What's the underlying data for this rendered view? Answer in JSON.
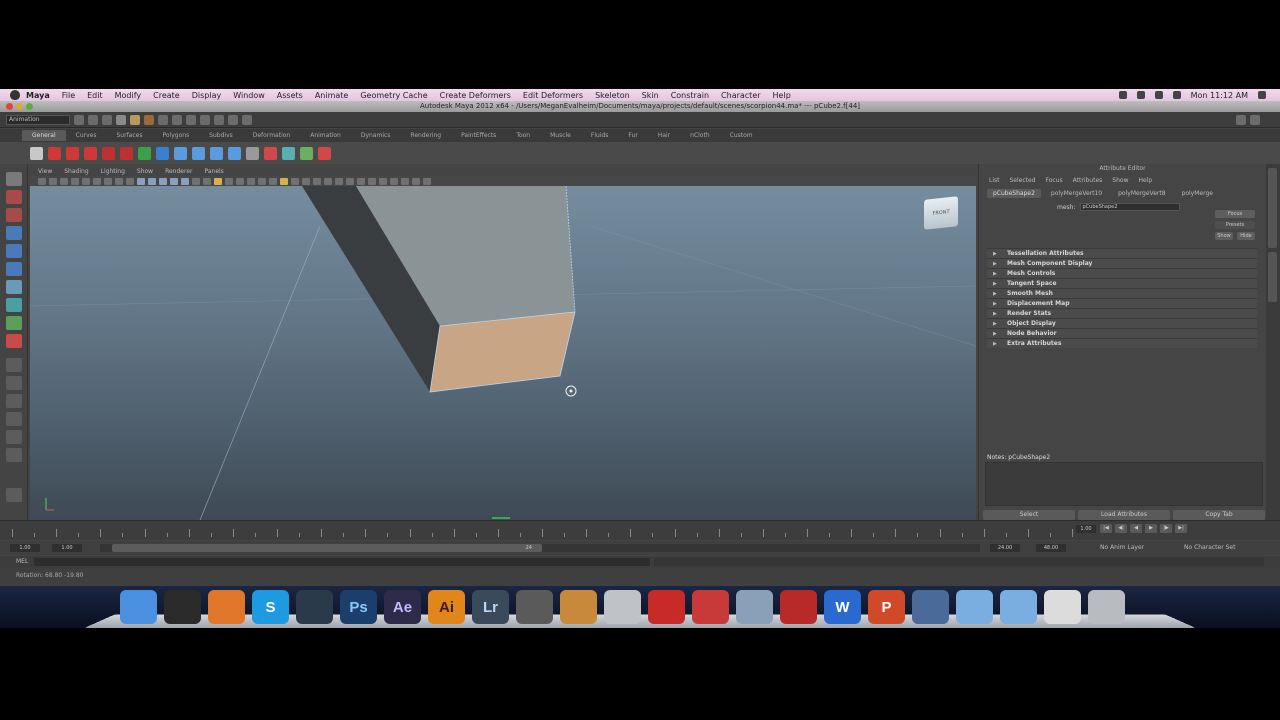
{
  "menubar": {
    "app": "Maya",
    "items": [
      "File",
      "Edit",
      "Modify",
      "Create",
      "Display",
      "Window",
      "Assets",
      "Animate",
      "Geometry Cache",
      "Create Deformers",
      "Edit Deformers",
      "Skeleton",
      "Skin",
      "Constrain",
      "Character",
      "Help"
    ],
    "clock": "Mon 11:12 AM"
  },
  "titlebar": {
    "title": "Autodesk Maya 2012 x64 - /Users/MeganEvalheim/Documents/maya/projects/default/scenes/scorpion44.ma* --- pCube2.f[44]"
  },
  "statusline": {
    "mode": "Animation"
  },
  "shelf": {
    "tabs": [
      "General",
      "Curves",
      "Surfaces",
      "Polygons",
      "Subdivs",
      "Deformation",
      "Animation",
      "Dynamics",
      "Rendering",
      "PaintEffects",
      "Toon",
      "Muscle",
      "Fluids",
      "Fur",
      "Hair",
      "nCloth",
      "Custom"
    ],
    "active_tab": "General",
    "icon_colors": [
      "#c8c8c8",
      "#d03838",
      "#d03838",
      "#d03838",
      "#c03030",
      "#c03030",
      "#3aa04a",
      "#3a7fd0",
      "#5a9be0",
      "#5a9be0",
      "#5a9be0",
      "#5a9be0",
      "#9a9a9a",
      "#d04848",
      "#58b0b0",
      "#6ab060",
      "#d04848"
    ]
  },
  "viewport": {
    "menu": [
      "View",
      "Shading",
      "Lighting",
      "Show",
      "Renderer",
      "Panels"
    ],
    "view_cube_label": "FRONT",
    "colors": {
      "top": "#758d9f",
      "bottom": "#3e4a55",
      "face_selected": "#c8a584",
      "face_top": "#8a9396",
      "face_side": "#3a3d40",
      "wire": "#b5d8f0"
    }
  },
  "attribute_editor": {
    "title": "Attribute Editor",
    "menu": [
      "List",
      "Selected",
      "Focus",
      "Attributes",
      "Show",
      "Help"
    ],
    "tabs": [
      "pCubeShape2",
      "polyMergeVert10",
      "polyMergeVert8",
      "polyMerge"
    ],
    "active_tab": "pCubeShape2",
    "mesh_label": "mesh:",
    "mesh_value": "pCubeShape2",
    "buttons_right": [
      "Focus",
      "Presets"
    ],
    "buttons_small": [
      "Show",
      "Hide"
    ],
    "sections": [
      "Tessellation Attributes",
      "Mesh Component Display",
      "Mesh Controls",
      "Tangent Space",
      "Smooth Mesh",
      "Displacement Map",
      "Render Stats",
      "Object Display",
      "Node Behavior",
      "Extra Attributes"
    ],
    "notes_label": "Notes: pCubeShape2",
    "bottom_buttons": [
      "Select",
      "Load Attributes",
      "Copy Tab"
    ]
  },
  "side_tabs": [
    "Channel Box / Layer Editor",
    "Attribute Editor"
  ],
  "timeslider": {
    "current_frame": "1.00",
    "playback": [
      "|◀",
      "◀|",
      "◀",
      "▶",
      "|▶",
      "▶|"
    ]
  },
  "rangeslider": {
    "start": "1.00",
    "start_inner": "1.00",
    "end_inner": "24.00",
    "end": "48.00",
    "range_label": "24",
    "anim_layer": "No Anim Layer",
    "character_set": "No Character Set"
  },
  "command_line": {
    "label": "MEL"
  },
  "help_line": {
    "text": "Rotation:   68.80    -19.80"
  },
  "dock": {
    "apps": [
      {
        "name": "Finder",
        "label": "",
        "color": "#4a8fe0",
        "fg": "#ffffff"
      },
      {
        "name": "Dashboard",
        "label": "",
        "color": "#2a2a2a",
        "fg": "#ffffff"
      },
      {
        "name": "Firefox",
        "label": "",
        "color": "#e0762a",
        "fg": "#ffffff"
      },
      {
        "name": "Skype",
        "label": "S",
        "color": "#1e9be0",
        "fg": "#ffffff"
      },
      {
        "name": "Maya",
        "label": "",
        "color": "#2b3a4a",
        "fg": "#ffffff"
      },
      {
        "name": "Photoshop",
        "label": "Ps",
        "color": "#1c3e6c",
        "fg": "#8ac8f8"
      },
      {
        "name": "After Effects",
        "label": "Ae",
        "color": "#2d2a4a",
        "fg": "#c8b8f8"
      },
      {
        "name": "Illustrator",
        "label": "Ai",
        "color": "#e0861a",
        "fg": "#3a1a00"
      },
      {
        "name": "Lightroom",
        "label": "Lr",
        "color": "#3a4a5a",
        "fg": "#b8d8f8"
      },
      {
        "name": "Final Cut",
        "label": "",
        "color": "#5a5a5a",
        "fg": "#ffffff"
      },
      {
        "name": "GarageBand",
        "label": "",
        "color": "#c88a3a",
        "fg": "#ffffff"
      },
      {
        "name": "Printer",
        "label": "",
        "color": "#bfc2c6",
        "fg": "#333333"
      },
      {
        "name": "Acrobat",
        "label": "",
        "color": "#c82a2a",
        "fg": "#ffffff"
      },
      {
        "name": "Flash",
        "label": "",
        "color": "#c83a3a",
        "fg": "#ffffff"
      },
      {
        "name": "Preview",
        "label": "",
        "color": "#8aa0b8",
        "fg": "#ffffff"
      },
      {
        "name": "Photo Booth",
        "label": "",
        "color": "#b82a2a",
        "fg": "#ffffff"
      },
      {
        "name": "Word",
        "label": "W",
        "color": "#2a6ad0",
        "fg": "#ffffff"
      },
      {
        "name": "PowerPoint",
        "label": "P",
        "color": "#d04a2a",
        "fg": "#ffffff"
      },
      {
        "name": "iMovie",
        "label": "",
        "color": "#4a6a9a",
        "fg": "#ffffff"
      },
      {
        "name": "Applications",
        "label": "",
        "color": "#7aaee0",
        "fg": "#ffffff"
      },
      {
        "name": "Documents",
        "label": "",
        "color": "#7aaee0",
        "fg": "#ffffff"
      },
      {
        "name": "Downloads",
        "label": "",
        "color": "#dcdcdc",
        "fg": "#333333"
      },
      {
        "name": "Trash",
        "label": "",
        "color": "#b8bcc0",
        "fg": "#333333"
      }
    ]
  }
}
